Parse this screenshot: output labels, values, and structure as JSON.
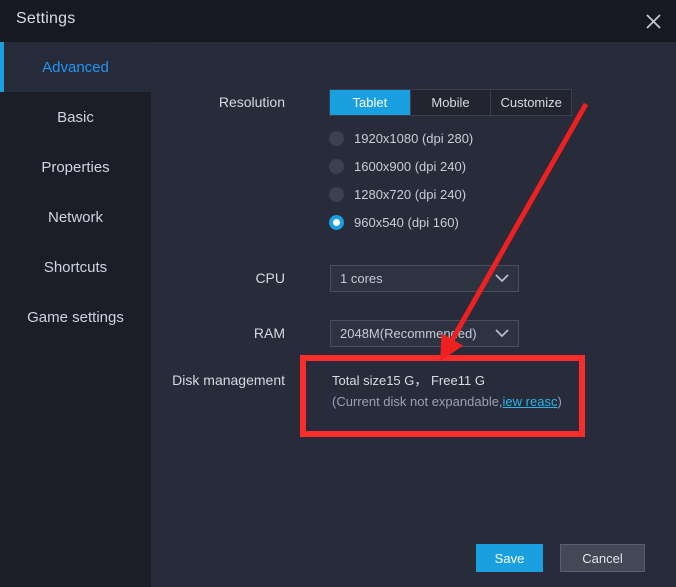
{
  "window": {
    "title": "Settings",
    "close_icon": "close-icon"
  },
  "sidebar": {
    "items": [
      {
        "label": "Advanced",
        "active": true
      },
      {
        "label": "Basic",
        "active": false
      },
      {
        "label": "Properties",
        "active": false
      },
      {
        "label": "Network",
        "active": false
      },
      {
        "label": "Shortcuts",
        "active": false
      },
      {
        "label": "Game settings",
        "active": false
      }
    ]
  },
  "form": {
    "resolution": {
      "label": "Resolution",
      "tabs": [
        {
          "label": "Tablet",
          "active": true
        },
        {
          "label": "Mobile",
          "active": false
        },
        {
          "label": "Customize",
          "active": false
        }
      ],
      "options": [
        {
          "label": "1920x1080  (dpi 280)",
          "checked": false
        },
        {
          "label": "1600x900  (dpi 240)",
          "checked": false
        },
        {
          "label": "1280x720  (dpi 240)",
          "checked": false
        },
        {
          "label": "960x540  (dpi 160)",
          "checked": true
        }
      ]
    },
    "cpu": {
      "label": "CPU",
      "value": "1 cores",
      "arrow_icon": "chevron-down-icon"
    },
    "ram": {
      "label": "RAM",
      "value": "2048M(Recommended)",
      "arrow_icon": "chevron-down-icon"
    },
    "disk": {
      "label": "Disk management",
      "summary": "Total size15 G， Free11 G",
      "note_prefix": "(Current disk not expandable,",
      "note_link": "iew reasc",
      "note_suffix": ")"
    }
  },
  "footer": {
    "save_label": "Save",
    "cancel_label": "Cancel"
  },
  "annotations": {
    "highlight_color": "#fa2c2c",
    "arrow_color": "#ee2020"
  }
}
